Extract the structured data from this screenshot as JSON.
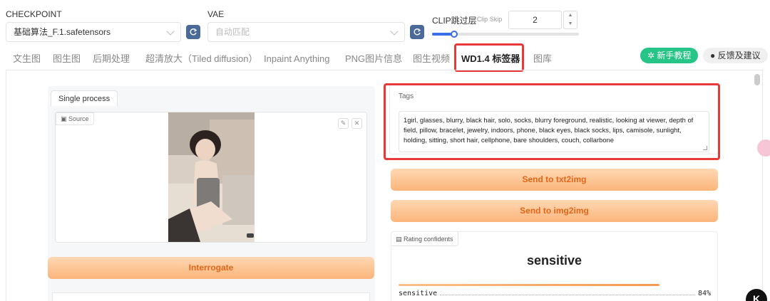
{
  "header": {
    "checkpoint_label": "CHECKPOINT",
    "checkpoint_value": "基础算法_F.1.safetensors",
    "vae_label": "VAE",
    "vae_value": "自动匹配",
    "clip_label": "CLIP跳过层",
    "clip_label_en": "Clip Skip",
    "clip_value": "2",
    "clip_slider_fraction": 0.15
  },
  "tabs": [
    {
      "label": "文生图"
    },
    {
      "label": "图生图"
    },
    {
      "label": "后期处理"
    },
    {
      "label": "超清放大（Tiled diffusion）"
    },
    {
      "label": "Inpaint Anything"
    },
    {
      "label": "PNG图片信息"
    },
    {
      "label": "图生视频"
    },
    {
      "label": "WD1.4 标签器"
    },
    {
      "label": "图库"
    }
  ],
  "actions": {
    "tutorial": "新手教程",
    "feedback": "反馈及建议"
  },
  "left": {
    "tab_label": "Single process",
    "source_label": "Source",
    "interrogate_label": "Interrogate"
  },
  "right": {
    "tags_label": "Tags",
    "tags_value": "1girl, glasses, blurry, black hair, solo, socks, blurry foreground, realistic, looking at viewer, depth of field, pillow, bracelet, jewelry, indoors, phone, black eyes, black socks, lips, camisole, sunlight, holding, sitting, short hair, cellphone, bare shoulders, couch, collarbone",
    "send_txt2img": "Send to txt2img",
    "send_img2img": "Send to img2img",
    "rating_label": "Rating confidents",
    "rating_top": "sensitive",
    "rating_rows": [
      {
        "name": "sensitive",
        "value": "84%",
        "fraction": 0.84
      }
    ]
  },
  "colors": {
    "accent_red": "#e8393a",
    "green": "#26c486",
    "orange_text": "#e4661a"
  }
}
